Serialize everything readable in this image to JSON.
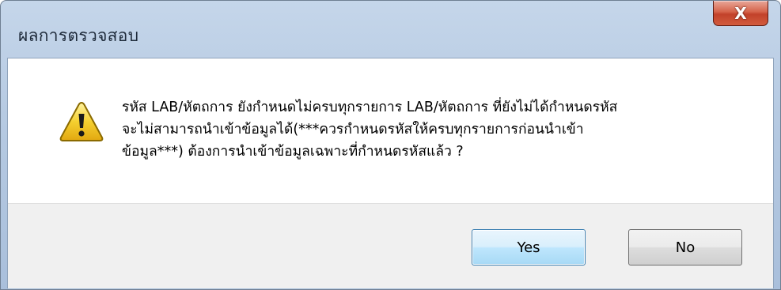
{
  "window": {
    "title": "ผลการตรวจสอบ",
    "close_glyph": "X"
  },
  "dialog": {
    "icon": "warning-icon",
    "message_lines": [
      "รหัส LAB/หัตถการ ยังกำหนดไม่ครบทุกรายการ LAB/หัตถการ ที่ยังไม่ได้กำหนดรหัส",
      "จะไม่สามารถนำเข้าข้อมูลได้(***ควรกำหนดรหัสให้ครบทุกรายการก่อนนำเข้า",
      "ข้อมูล***) ต้องการนำเข้าข้อมูลเฉพาะที่กำหนดรหัสแล้ว ?"
    ]
  },
  "buttons": {
    "yes_label": "Yes",
    "no_label": "No"
  },
  "colors": {
    "warning_fill": "#f5d030",
    "warning_border": "#8a6a00",
    "close_button": "#c8452b",
    "default_button_border": "#3c7fb1"
  }
}
